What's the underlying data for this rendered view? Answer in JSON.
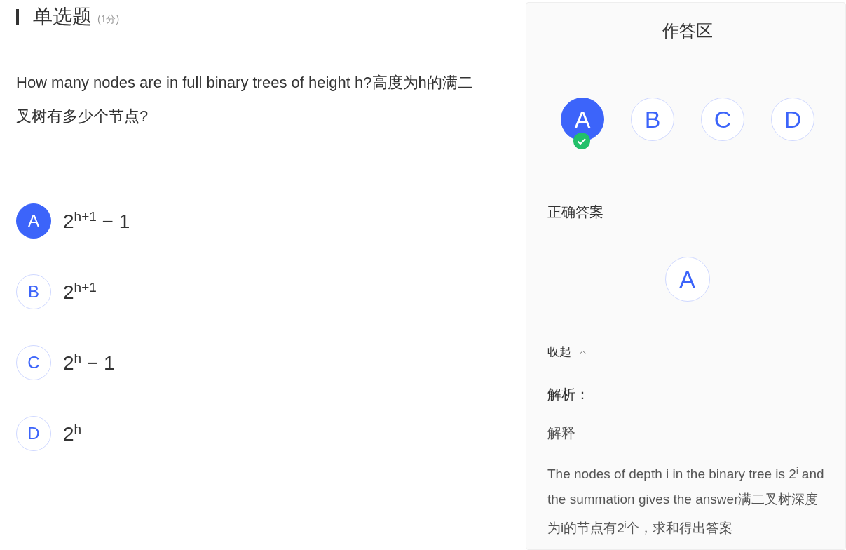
{
  "question": {
    "type": "单选题",
    "score": "(1分)",
    "text": "How many nodes are in full binary trees of height h?高度为h的满二叉树有多少个节点?"
  },
  "options": [
    {
      "letter": "A",
      "text": "2$^{h+1}$ − 1",
      "selected": true
    },
    {
      "letter": "B",
      "text": "2$^{h+1}$",
      "selected": false
    },
    {
      "letter": "C",
      "text": "2$^{h}$ − 1",
      "selected": false
    },
    {
      "letter": "D",
      "text": "2$^{h}$",
      "selected": false
    }
  ],
  "answer_panel": {
    "title": "作答区",
    "choices": [
      {
        "letter": "A",
        "selected": true,
        "correct": true
      },
      {
        "letter": "B",
        "selected": false,
        "correct": false
      },
      {
        "letter": "C",
        "selected": false,
        "correct": false
      },
      {
        "letter": "D",
        "selected": false,
        "correct": false
      }
    ],
    "correct_answer_label": "正确答案",
    "correct_answer": "A",
    "toggle": {
      "label": "收起",
      "expanded": true
    },
    "analysis_label": "解析：",
    "explanation_title": "解释",
    "explanation": "The nodes of depth i in the binary tree is 2$^{i}$ and the summation gives the answer满二叉树深度为i的节点有2$^{i}$个，求和得出答案"
  }
}
